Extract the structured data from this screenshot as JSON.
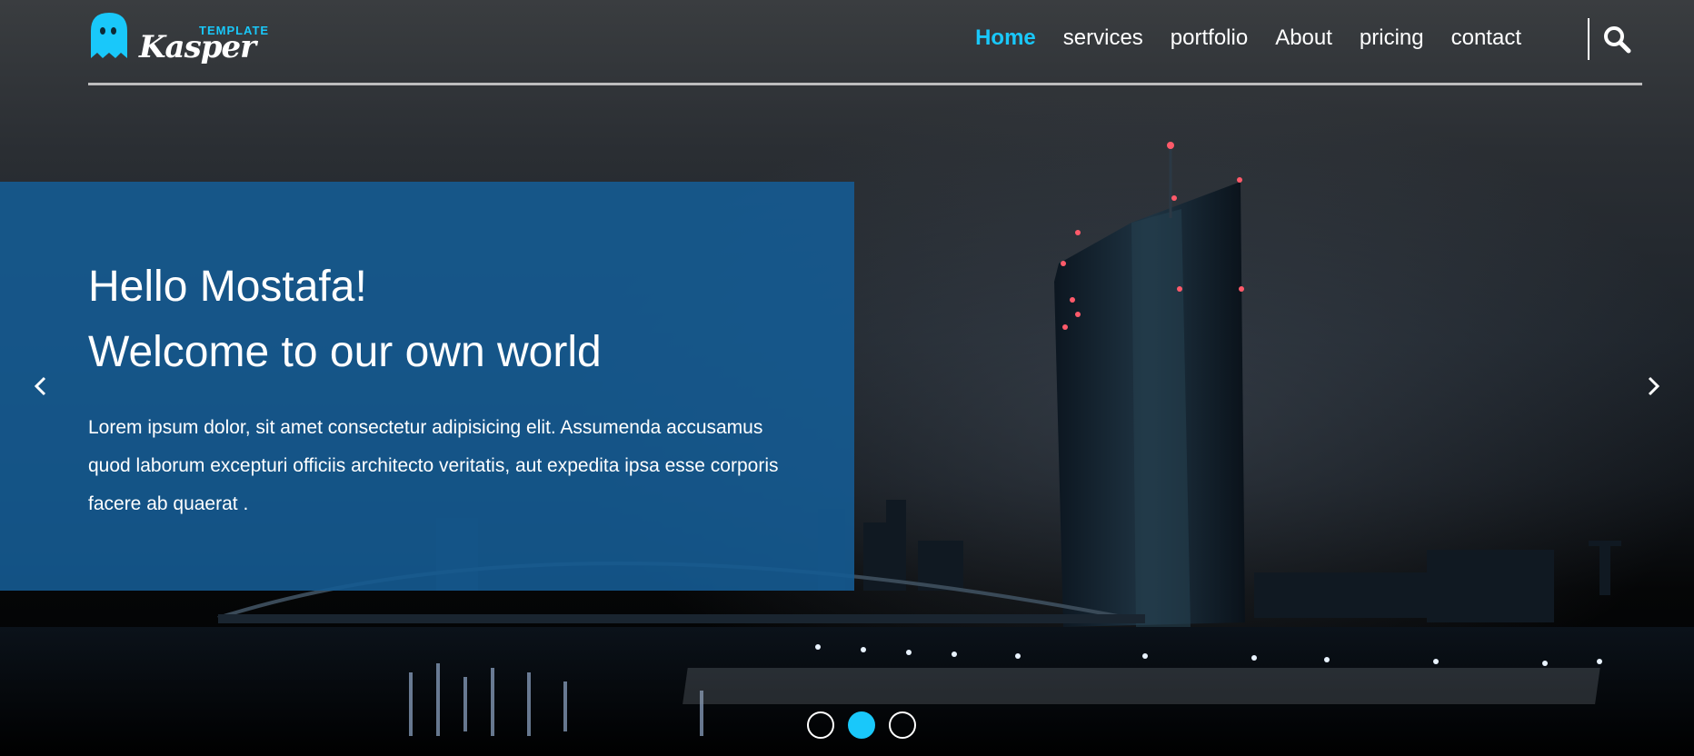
{
  "brand": {
    "small_label": "TEMPLATE",
    "name": "Kasper",
    "accent_color": "#19c8fa",
    "icon": "ghost-icon"
  },
  "nav": {
    "items": [
      {
        "label": "Home",
        "active": true
      },
      {
        "label": "services",
        "active": false
      },
      {
        "label": "portfolio",
        "active": false
      },
      {
        "label": "About",
        "active": false
      },
      {
        "label": "pricing",
        "active": false
      },
      {
        "label": "contact",
        "active": false
      }
    ],
    "search_icon": "search-icon"
  },
  "hero": {
    "heading_line1": "Hello Mostafa!",
    "heading_line2": "Welcome to our own world",
    "paragraph": "Lorem ipsum dolor, sit amet consectetur adipisicing elit. Assumenda accusamus quod laborum excepturi officiis architecto veritatis, aut expedita ipsa esse corporis facere ab quaerat .",
    "box_color": "#155b92",
    "prev_icon": "chevron-left-icon",
    "next_icon": "chevron-right-icon"
  },
  "slider": {
    "slides": 3,
    "active_index": 1
  }
}
